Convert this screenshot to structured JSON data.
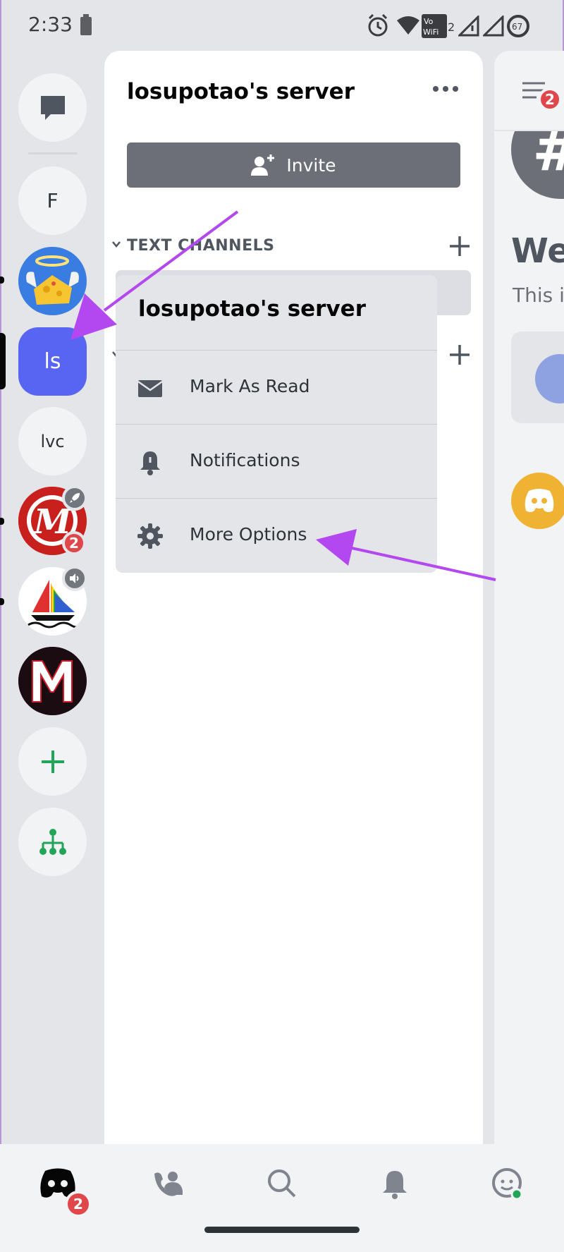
{
  "status_bar": {
    "time": "2:33",
    "network_badge": "2",
    "battery_percent": "67",
    "icons": [
      "battery-icon",
      "alarm-icon",
      "wifi-icon",
      "vowifi-icon",
      "signal-icon",
      "battery-ring-icon"
    ]
  },
  "server_rail": {
    "items": [
      {
        "kind": "direct-messages",
        "icon": "chat-bubble-icon"
      },
      {
        "kind": "server",
        "label": "F"
      },
      {
        "kind": "server",
        "icon": "cheese-avatar-icon",
        "unread": true
      },
      {
        "kind": "server",
        "label": "ls",
        "selected": true
      },
      {
        "kind": "server",
        "label": "lvc"
      },
      {
        "kind": "server",
        "icon": "red-m-logo-icon",
        "badge": "2",
        "boost_icon": "rocket-icon",
        "unread": true
      },
      {
        "kind": "server",
        "icon": "rainbow-sailboat-icon",
        "voice_icon": "speaker-icon",
        "unread": true
      },
      {
        "kind": "server",
        "icon": "black-m-logo-icon"
      },
      {
        "kind": "add-server",
        "icon": "plus-icon"
      },
      {
        "kind": "discover",
        "icon": "hub-tree-icon"
      }
    ]
  },
  "channel_panel": {
    "server_name": "losupotao's server",
    "invite_label": "Invite",
    "category_label": "TEXT CHANNELS"
  },
  "context_menu": {
    "title": "losupotao's server",
    "items": [
      {
        "label": "Mark As Read",
        "icon": "envelope-icon"
      },
      {
        "label": "Notifications",
        "icon": "bell-icon"
      },
      {
        "label": "More Options",
        "icon": "gear-icon"
      }
    ]
  },
  "right_panel": {
    "welcome": "We",
    "subtitle": "This i",
    "header_badge": "2"
  },
  "bottom_nav": {
    "home_badge": "2",
    "items": [
      "home-discord-icon",
      "friends-icon",
      "search-icon",
      "notifications-bell-icon",
      "profile-icon"
    ]
  },
  "colors": {
    "blurple": "#5865f2",
    "annotation_arrow": "#b347f0",
    "badge_red": "#e0474b",
    "invite_grey": "#6d6f78"
  }
}
